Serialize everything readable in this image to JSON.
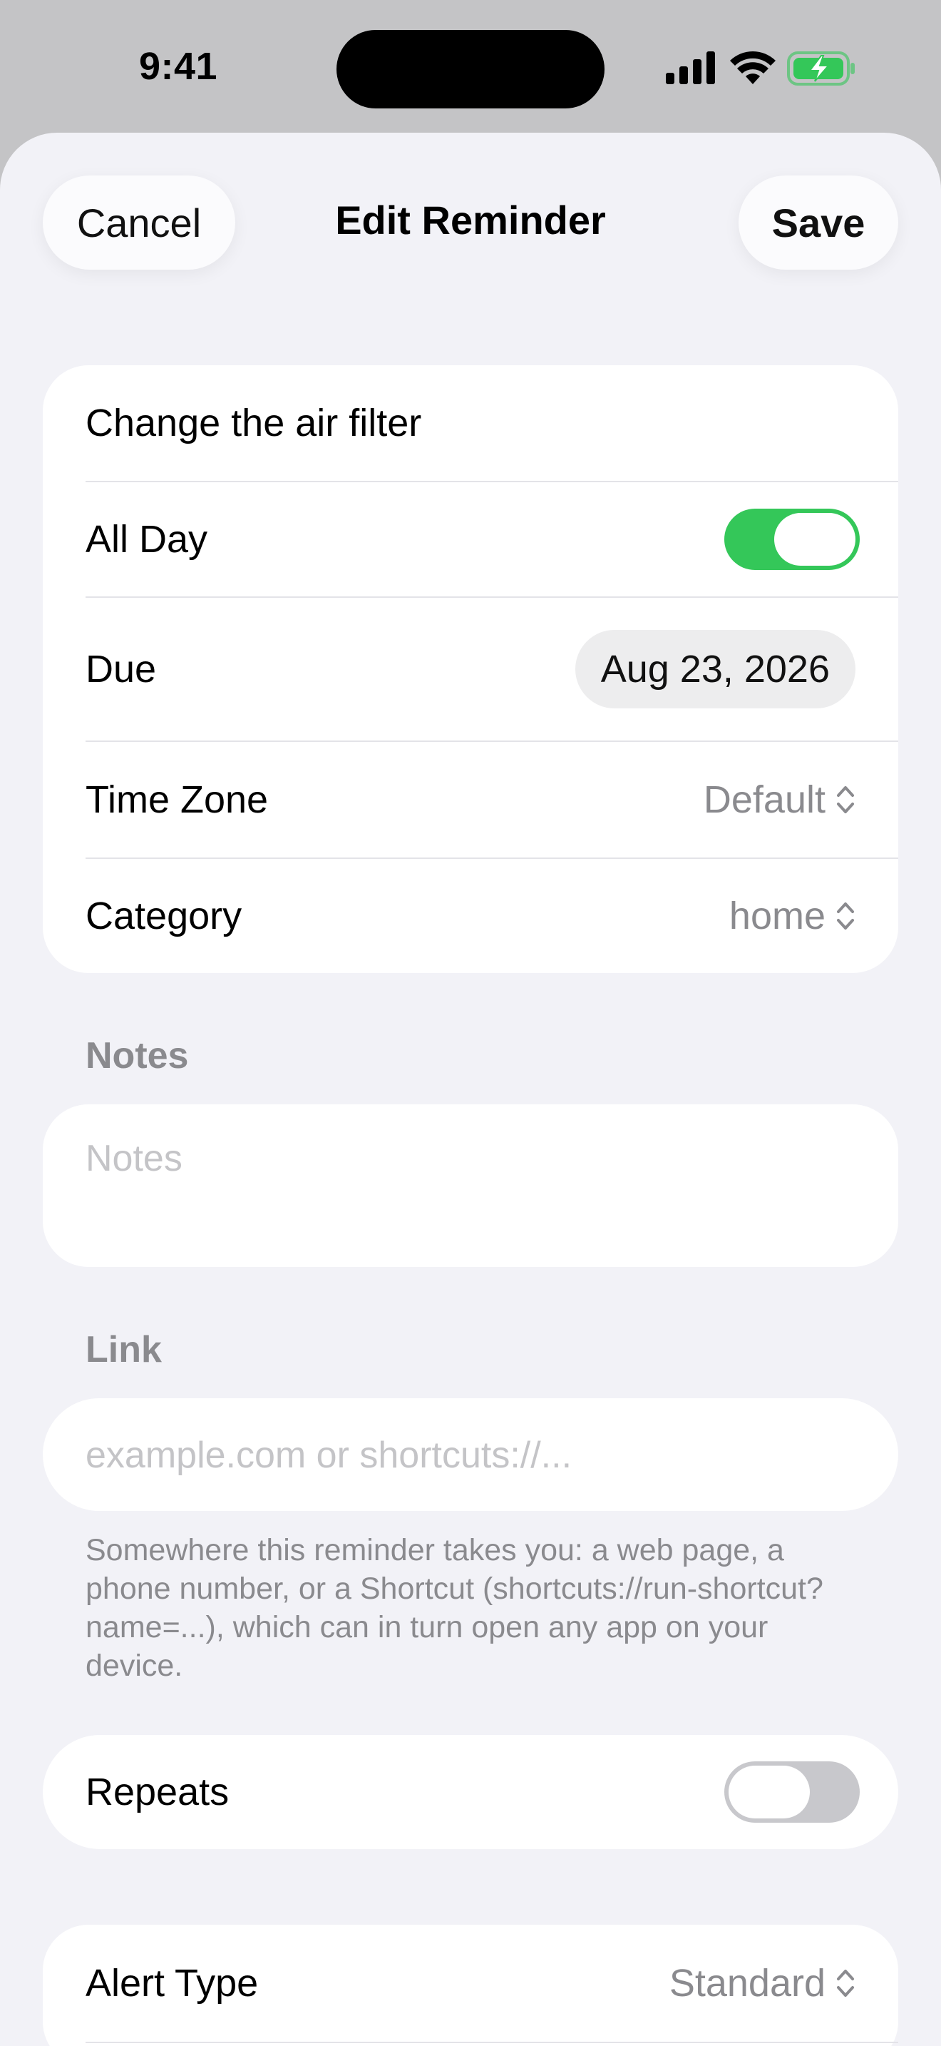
{
  "status_bar": {
    "time": "9:41",
    "icons": [
      "signal-icon",
      "wifi-icon",
      "battery-charging-icon"
    ],
    "battery_color": "#34c759"
  },
  "nav": {
    "cancel_label": "Cancel",
    "title": "Edit Reminder",
    "save_label": "Save"
  },
  "details": {
    "title_value": "Change the air filter",
    "all_day_label": "All Day",
    "all_day_on": true,
    "due_label": "Due",
    "due_value": "Aug 23, 2026",
    "time_zone_label": "Time Zone",
    "time_zone_value": "Default",
    "category_label": "Category",
    "category_value": "home"
  },
  "notes": {
    "section_label": "Notes",
    "placeholder": "Notes"
  },
  "link": {
    "section_label": "Link",
    "placeholder": "example.com or shortcuts://...",
    "footnote": "Somewhere this reminder takes you: a web page, a phone number, or a Shortcut (shortcuts://run-shortcut?name=...), which can in turn open any app on your device."
  },
  "repeats": {
    "label": "Repeats",
    "on": false
  },
  "alert": {
    "label": "Alert Type",
    "value": "Standard"
  },
  "colors": {
    "accent_green": "#34c759",
    "background": "#f2f2f7",
    "secondary_text": "#8a8a8e"
  }
}
